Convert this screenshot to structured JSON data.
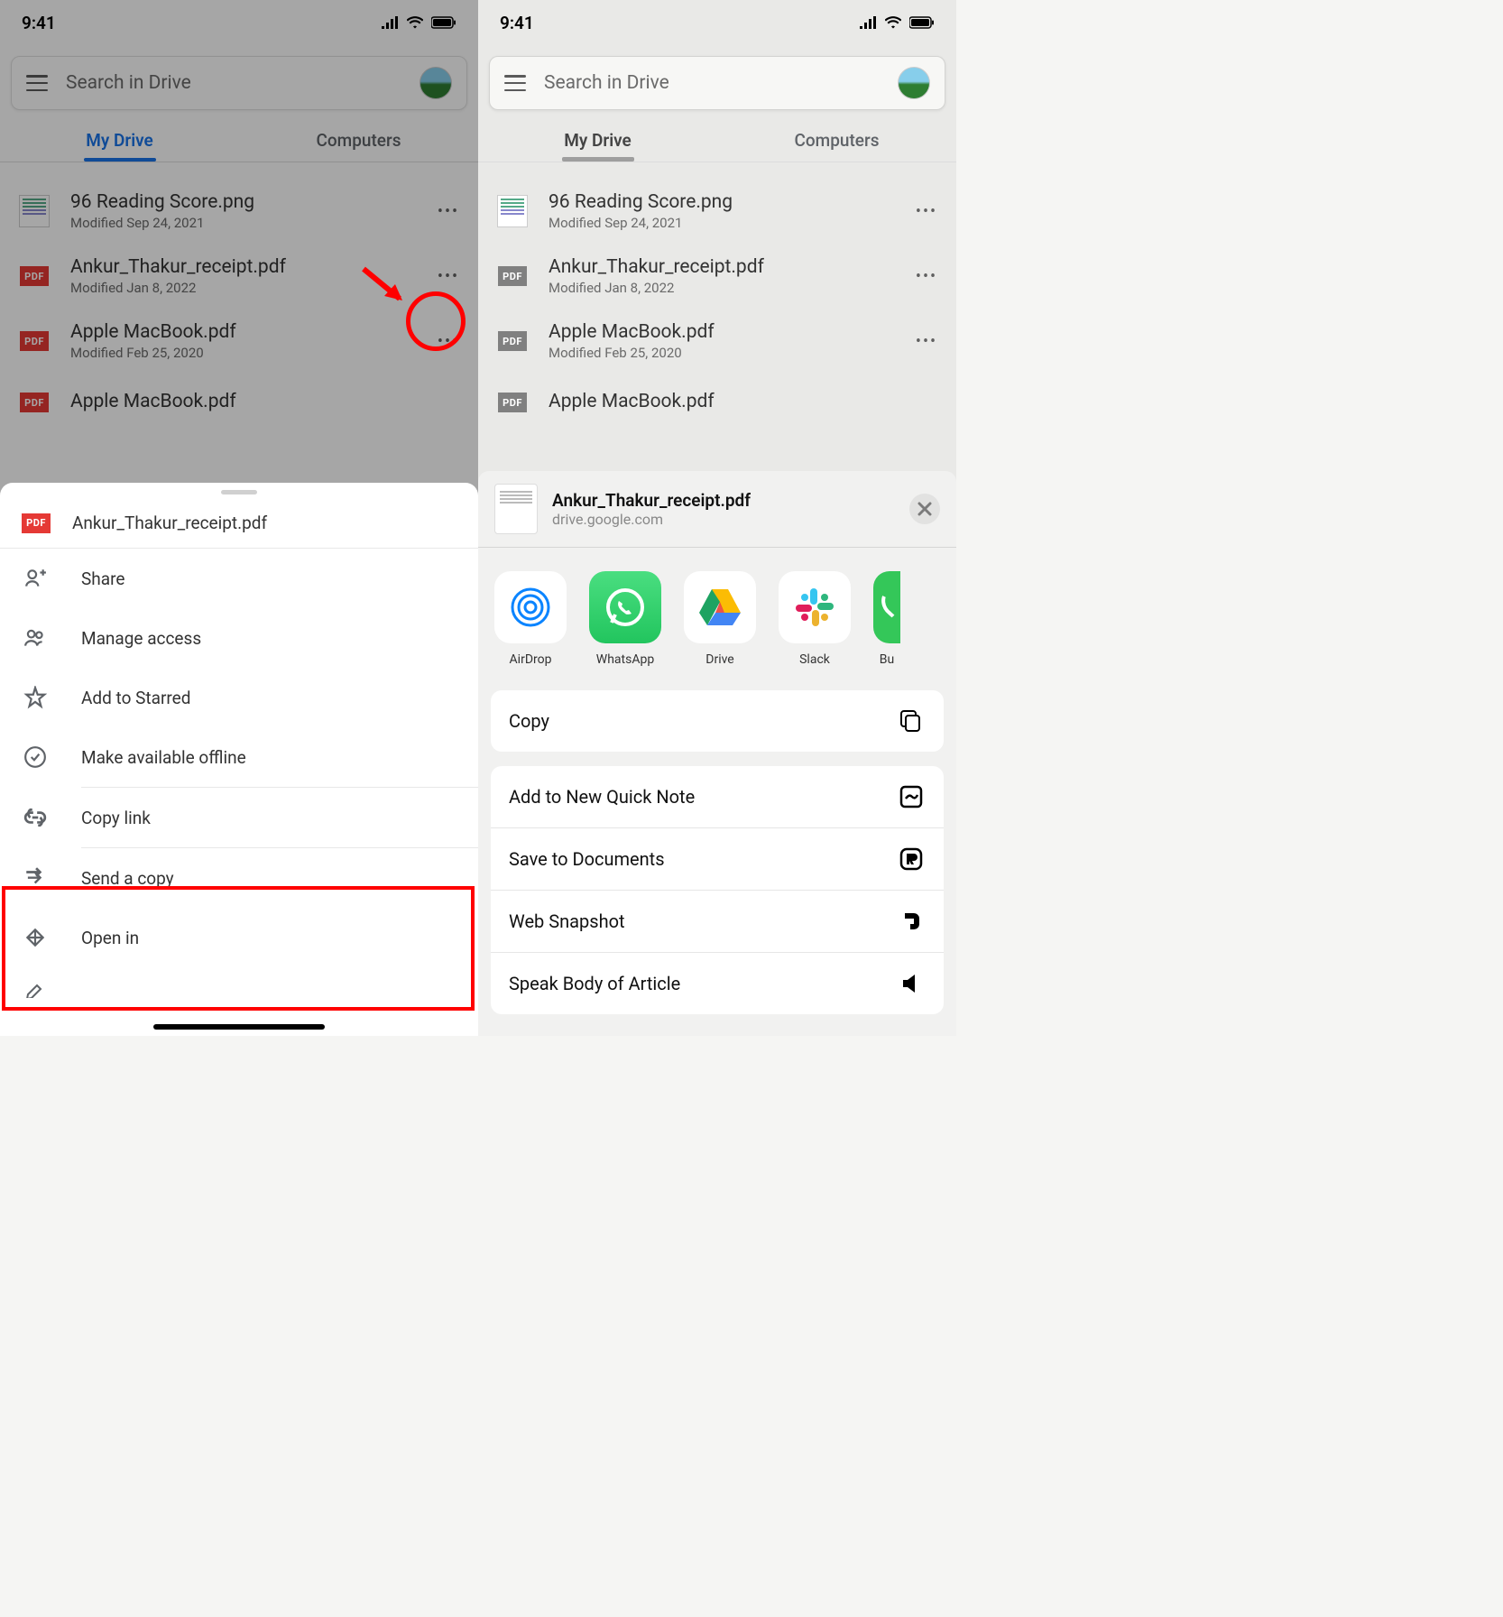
{
  "status": {
    "time": "9:41"
  },
  "search": {
    "placeholder": "Search in Drive"
  },
  "tabs": {
    "my_drive": "My Drive",
    "computers": "Computers"
  },
  "files": [
    {
      "name": "96 Reading Score.png",
      "meta": "Modified Sep 24, 2021",
      "type": "png"
    },
    {
      "name": "Ankur_Thakur_receipt.pdf",
      "meta": "Modified Jan 8, 2022",
      "type": "pdf"
    },
    {
      "name": "Apple MacBook.pdf",
      "meta": "Modified Feb 25, 2020",
      "type": "pdf"
    },
    {
      "name": "Apple MacBook.pdf",
      "meta": "",
      "type": "pdf"
    }
  ],
  "drive_sheet": {
    "file": "Ankur_Thakur_receipt.pdf",
    "items": {
      "share": "Share",
      "manage_access": "Manage access",
      "add_starred": "Add to Starred",
      "offline": "Make available offline",
      "copy_link": "Copy link",
      "send_copy": "Send a copy",
      "open_in": "Open in"
    }
  },
  "share_sheet": {
    "file": "Ankur_Thakur_receipt.pdf",
    "source": "drive.google.com",
    "apps": {
      "airdrop": "AirDrop",
      "whatsapp": "WhatsApp",
      "drive": "Drive",
      "slack": "Slack",
      "bu": "Bu"
    },
    "actions": {
      "copy": "Copy",
      "quick_note": "Add to New Quick Note",
      "save_docs": "Save to Documents",
      "web_snapshot": "Web Snapshot",
      "speak": "Speak Body of Article"
    }
  }
}
